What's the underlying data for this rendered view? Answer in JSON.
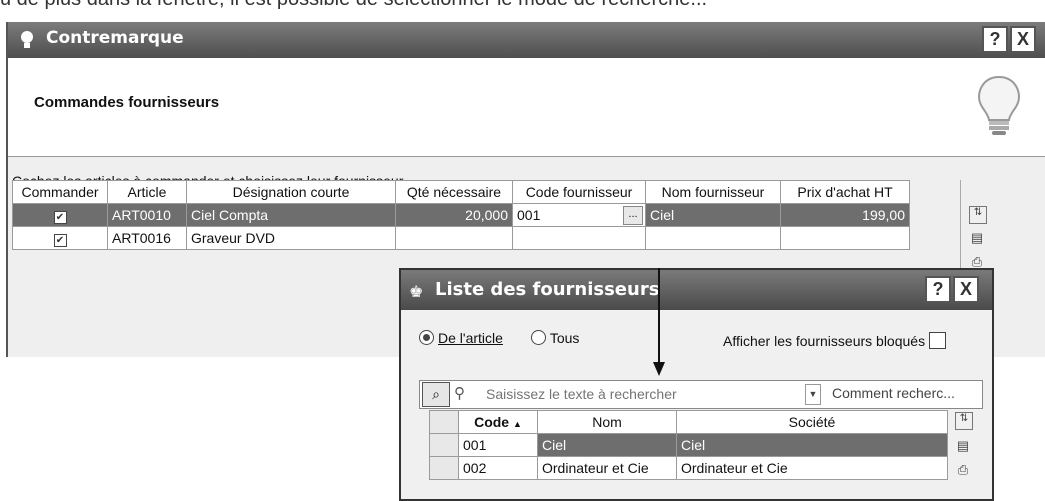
{
  "top_strip_text": "u de plus dans la fenêtre, il est possible de sélectionner le mode de recherche...",
  "main_window": {
    "title": "Contremarque",
    "help_button": "?",
    "close_button": "X",
    "header_title": "Commandes fournisseurs",
    "instruction": "Cochez les articles à commander et choisissez leur fournisseur",
    "columns": [
      "Commander",
      "Article",
      "Désignation courte",
      "Qté nécessaire",
      "Code fournisseur",
      "Nom fournisseur",
      "Prix d'achat HT"
    ],
    "rows": [
      {
        "commander": "checked",
        "article": "ART0010",
        "designation": "Ciel Compta",
        "qte": "20,000",
        "code": "001",
        "code_btn": "...",
        "nom": "Ciel",
        "prix": "199,00",
        "selected": true
      },
      {
        "commander": "checked",
        "article": "ART0016",
        "designation": "Graveur DVD",
        "qte": "",
        "code": "",
        "code_btn": "",
        "nom": "",
        "prix": "",
        "selected": false
      }
    ],
    "side_icons": [
      "table-settings-icon",
      "monitor-icon",
      "printer-icon",
      "play-icon",
      "scroll-up-icon"
    ]
  },
  "popup": {
    "title": "Liste des fournisseurs",
    "help_button": "?",
    "close_button": "X",
    "radio_article": "De l'article",
    "radio_tous": "Tous",
    "show_blocked_label": "Afficher les fournisseurs bloqués",
    "search_placeholder": "Saisissez le texte à rechercher",
    "search_mode": "Comment recherc...",
    "columns": [
      "Code",
      "Nom",
      "Société"
    ],
    "sort_indicator": "▲",
    "rows": [
      {
        "code": "001",
        "nom": "Ciel",
        "societe": "Ciel",
        "selected": true
      },
      {
        "code": "002",
        "nom": "Ordinateur et Cie",
        "societe": "Ordinateur et Cie",
        "selected": false
      }
    ]
  },
  "colors": {
    "titlebar": "#5a5a5a",
    "selected_row": "#6e6e6e",
    "window_bg": "#efefef"
  }
}
